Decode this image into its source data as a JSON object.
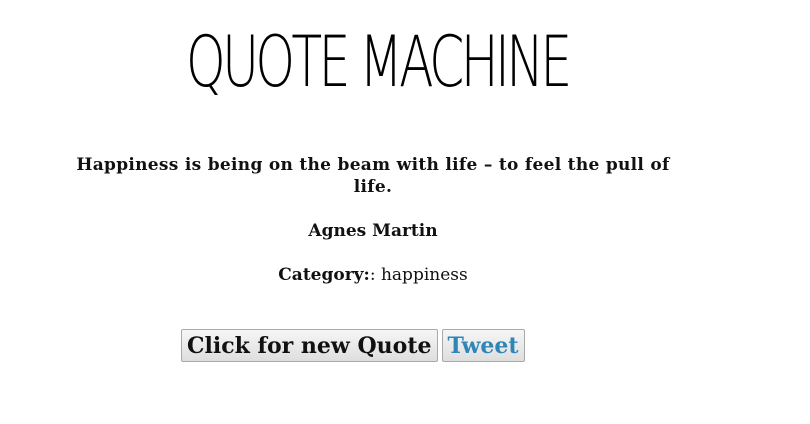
{
  "header": {
    "title": "QUOTE MACHINE"
  },
  "quote": {
    "text": "Happiness is being on the beam with life – to feel the pull of life.",
    "author": "Agnes Martin",
    "category_label": "Category:",
    "category_value": ": happiness"
  },
  "actions": {
    "new_quote_label": "Click for new Quote",
    "tweet_label": "Tweet"
  },
  "colors": {
    "tweet_text": "#2e86b8",
    "text": "#111111",
    "background": "#ffffff"
  }
}
